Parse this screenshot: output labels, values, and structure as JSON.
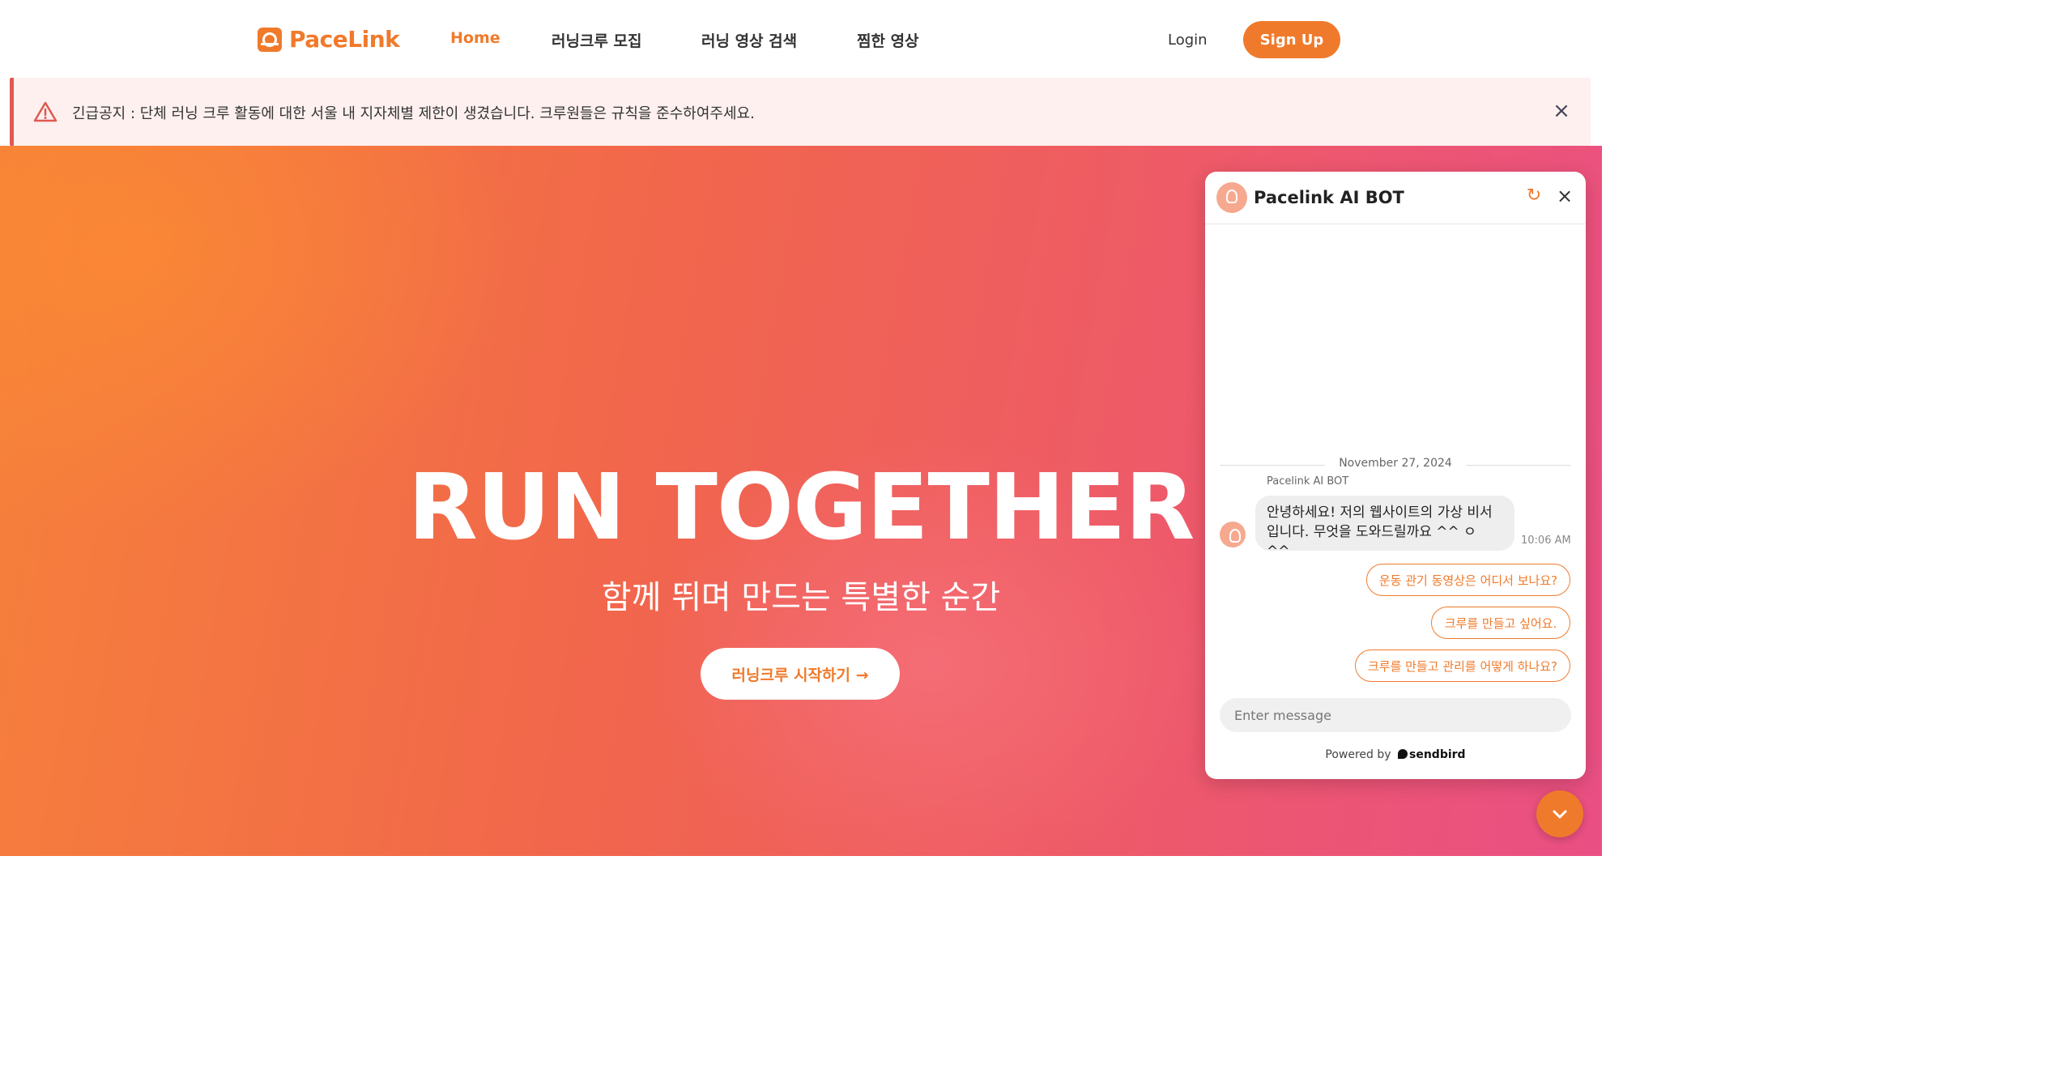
{
  "brand": {
    "name": "PaceLink",
    "accent": "#f07a2b"
  },
  "nav": {
    "links": [
      {
        "label": "Home",
        "active": true
      },
      {
        "label": "러닝크루 모집",
        "active": false
      },
      {
        "label": "러닝 영상 검색",
        "active": false
      },
      {
        "label": "찜한 영상",
        "active": false
      }
    ],
    "login": "Login",
    "signup": "Sign Up"
  },
  "notice": {
    "text": "긴급공지 : 단체 러닝 크루 활동에 대한 서울 내 지자체별 제한이 생겼습니다. 크루원들은 규칙을 준수하여주세요.",
    "icon": "warning-triangle-icon",
    "color": "#e05a50"
  },
  "hero": {
    "title": "RUN TOGETHER",
    "subtitle": "함께 뛰며 만드는 특별한 순간",
    "cta": "러닝크루 시작하기 →"
  },
  "chat": {
    "title": "Pacelink AI BOT",
    "date": "November 27, 2024",
    "sender": "Pacelink AI BOT",
    "message": "안녕하세요! 저의 웹사이트의 가상 비서입니다. 무엇을 도와드릴까요 ^^ ㅇ ^^",
    "time": "10:06 AM",
    "suggestions": [
      "운동 관기 동영상은 어디서 보나요?",
      "크루를 만들고 싶어요.",
      "크루를 만들고 관리를 어떻게 하나요?"
    ],
    "input_placeholder": "Enter message",
    "powered_prefix": "Powered by",
    "powered_brand": "sendbird"
  }
}
